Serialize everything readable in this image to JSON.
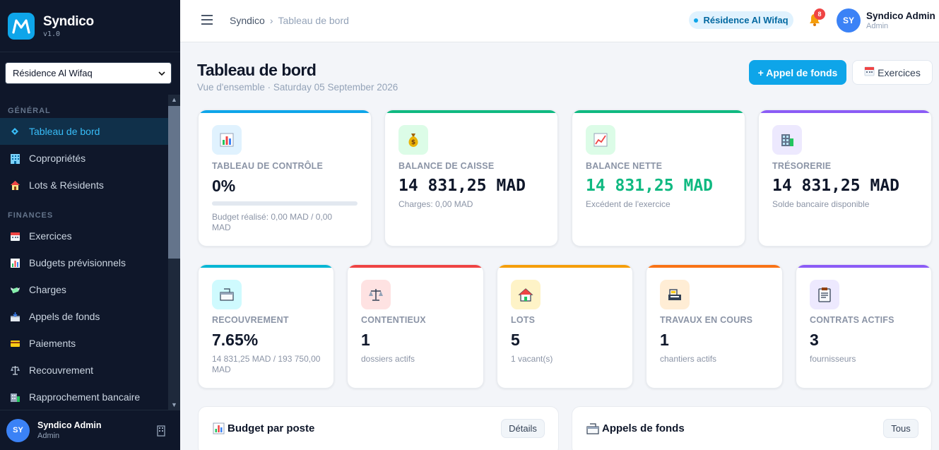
{
  "brand": {
    "name": "Syndico",
    "version": "v1.0"
  },
  "residence_select": {
    "value": "Résidence Al Wifaq"
  },
  "nav": {
    "sections": [
      {
        "title": "GÉNÉRAL",
        "items": [
          {
            "label": "Tableau de bord",
            "icon": "diamond-icon",
            "active": true
          },
          {
            "label": "Copropriétés",
            "icon": "building-icon"
          },
          {
            "label": "Lots & Résidents",
            "icon": "house-icon"
          }
        ]
      },
      {
        "title": "FINANCES",
        "items": [
          {
            "label": "Exercices",
            "icon": "calendar-icon"
          },
          {
            "label": "Budgets prévisionnels",
            "icon": "bar-chart-icon"
          },
          {
            "label": "Charges",
            "icon": "money-wings-icon"
          },
          {
            "label": "Appels de fonds",
            "icon": "inbox-tray-icon"
          },
          {
            "label": "Paiements",
            "icon": "credit-card-icon"
          },
          {
            "label": "Recouvrement",
            "icon": "scales-icon"
          },
          {
            "label": "Rapprochement bancaire",
            "icon": "bank-building-icon"
          }
        ]
      }
    ]
  },
  "sidebar_user": {
    "initials": "SY",
    "name": "Syndico Admin",
    "role": "Admin"
  },
  "topbar": {
    "breadcrumb": {
      "root": "Syndico",
      "separator": "›",
      "current": "Tableau de bord"
    },
    "residence_badge": "Résidence Al Wifaq",
    "notifications_count": "8",
    "user": {
      "initials": "SY",
      "name": "Syndico Admin",
      "role": "Admin"
    }
  },
  "page": {
    "title": "Tableau de bord",
    "subtitle": "Vue d'ensemble · Saturday 05 September 2026",
    "primary_button": "+ Appel de fonds",
    "secondary_button": "Exercices"
  },
  "kpis_row1": [
    {
      "label": "TABLEAU DE CONTRÔLE",
      "value": "0%",
      "sub": "Budget réalisé: 0,00 MAD / 0,00 MAD",
      "progress": 0,
      "accent": "#0ea5e9",
      "icon": "bar-chart-icon",
      "icon_bg": "#e0f2fe"
    },
    {
      "label": "BALANCE DE CAISSE",
      "value": "14 831,25 MAD",
      "sub": "Charges: 0,00 MAD",
      "accent": "#10b981",
      "icon": "money-bag-icon",
      "icon_bg": "#dcfce7"
    },
    {
      "label": "BALANCE NETTE",
      "value": "14 831,25 MAD",
      "sub": "Excédent de l'exercice",
      "accent": "#10b981",
      "value_color": "#10b981",
      "icon": "line-chart-icon",
      "icon_bg": "#dcfce7"
    },
    {
      "label": "TRÉSORERIE",
      "value": "14 831,25 MAD",
      "sub": "Solde bancaire disponible",
      "accent": "#8b5cf6",
      "icon": "office-building-icon",
      "icon_bg": "#ede9fe"
    }
  ],
  "kpis_row2": [
    {
      "label": "RECOUVREMENT",
      "value": "7.65%",
      "sub": "14 831,25 MAD / 193 750,00 MAD",
      "accent": "#06b6d4",
      "icon": "inbox-tray-icon",
      "icon_bg": "#cffafe"
    },
    {
      "label": "CONTENTIEUX",
      "value": "1",
      "sub": "dossiers actifs",
      "accent": "#ef4444",
      "icon": "scales-icon",
      "icon_bg": "#fee2e2"
    },
    {
      "label": "LOTS",
      "value": "5",
      "sub": "1 vacant(s)",
      "accent": "#f59e0b",
      "icon": "house-icon",
      "icon_bg": "#fef3c7"
    },
    {
      "label": "TRAVAUX EN COURS",
      "value": "1",
      "sub": "chantiers actifs",
      "accent": "#f97316",
      "icon": "construction-icon",
      "icon_bg": "#ffedd5"
    },
    {
      "label": "CONTRATS ACTIFS",
      "value": "3",
      "sub": "fournisseurs",
      "accent": "#8b5cf6",
      "icon": "clipboard-icon",
      "icon_bg": "#ede9fe"
    }
  ],
  "panels": [
    {
      "title": "Budget par poste",
      "icon": "bar-chart-icon",
      "button": "Détails"
    },
    {
      "title": "Appels de fonds",
      "icon": "inbox-tray-icon",
      "button": "Tous"
    }
  ]
}
